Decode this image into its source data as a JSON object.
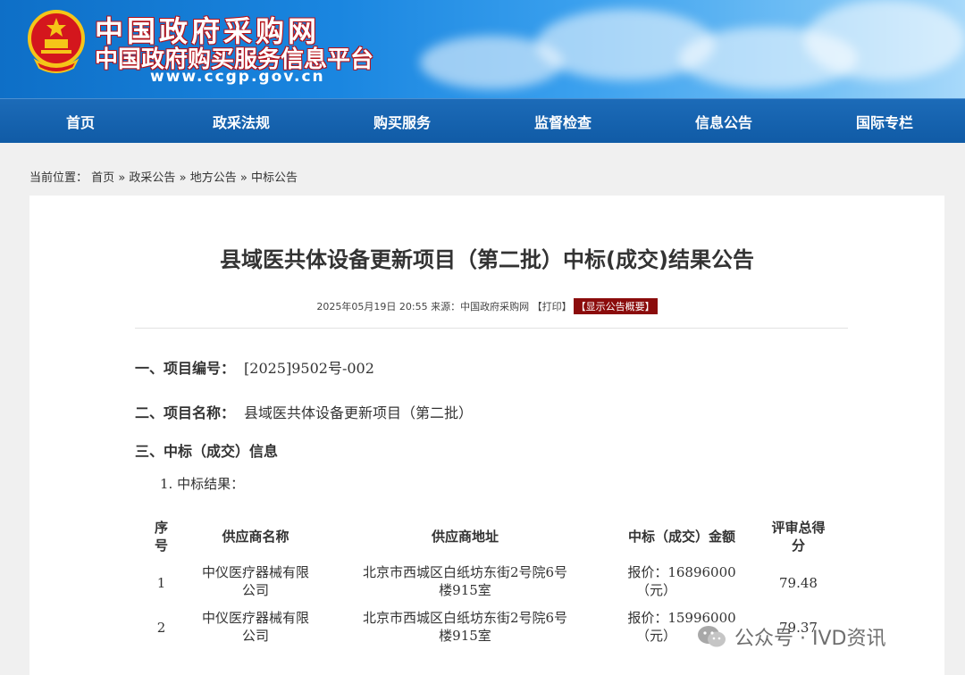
{
  "site": {
    "title_main": "中国政府采购网",
    "title_sub": "中国政府购买服务信息平台",
    "url": "www.ccgp.gov.cn"
  },
  "nav": [
    {
      "label": "首页"
    },
    {
      "label": "政采法规"
    },
    {
      "label": "购买服务"
    },
    {
      "label": "监督检查"
    },
    {
      "label": "信息公告"
    },
    {
      "label": "国际专栏"
    }
  ],
  "breadcrumb": {
    "prefix": "当前位置：",
    "items": [
      "首页",
      "政采公告",
      "地方公告",
      "中标公告"
    ],
    "separator": "»"
  },
  "article": {
    "title": "县域医共体设备更新项目（第二批）中标(成交)结果公告",
    "meta": "2025年05月19日 20:55 来源：中国政府采购网 【打印】",
    "summary_button": "【显示公告概要】",
    "sections": [
      {
        "label": "一、项目编号：",
        "value": "[2025]9502号-002"
      },
      {
        "label": "二、项目名称：",
        "value": "县域医共体设备更新项目（第二批）"
      },
      {
        "label": "三、中标（成交）信息",
        "value": ""
      }
    ],
    "result_label": "1. 中标结果："
  },
  "table": {
    "headers": {
      "seq": [
        "序",
        "号"
      ],
      "supplier": "供应商名称",
      "address": "供应商地址",
      "amount": "中标（成交）金额",
      "score": [
        "评审总得",
        "分"
      ]
    },
    "rows": [
      {
        "seq": "1",
        "supplier": [
          "中仪医疗器械有限",
          "公司"
        ],
        "address": [
          "北京市西城区白纸坊东街2号院6号",
          "楼915室"
        ],
        "amount": [
          "报价：16896000",
          "（元）"
        ],
        "score": "79.48"
      },
      {
        "seq": "2",
        "supplier": [
          "中仪医疗器械有限",
          "公司"
        ],
        "address": [
          "北京市西城区白纸坊东街2号院6号",
          "楼915室"
        ],
        "amount": [
          "报价：15996000",
          "（元）"
        ],
        "score": "79.37"
      }
    ]
  },
  "watermark": {
    "text": "公众号 · IVD资讯",
    "icon": "wechat-icon"
  },
  "colors": {
    "nav_bg": "#105ba6",
    "summary_button_bg": "#8b0c0c",
    "banner_blue": "#1a86e0"
  }
}
